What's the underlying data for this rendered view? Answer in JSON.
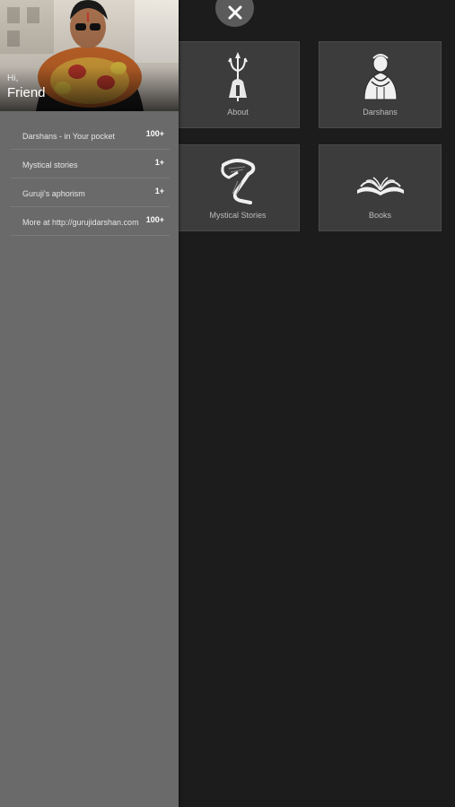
{
  "close_button": {
    "icon": "close-icon"
  },
  "tiles": {
    "about": {
      "label": "About",
      "icon": "trident-icon"
    },
    "darshans": {
      "label": "Darshans",
      "icon": "guru-portrait-icon"
    },
    "stories": {
      "label": "Mystical Stories",
      "icon": "cobra-icon"
    },
    "books": {
      "label": "Books",
      "icon": "open-book-icon"
    }
  },
  "drawer": {
    "greeting": "Hi,",
    "name": "Friend",
    "profile_image": "guru-photo-with-garlands",
    "items": [
      {
        "label": "Darshans - in Your pocket",
        "count": "100+"
      },
      {
        "label": "Mystical stories",
        "count": "1+"
      },
      {
        "label": "Guruji's aphorism",
        "count": "1+"
      },
      {
        "label": "More at http://gurujidarshan.com",
        "count": "100+"
      }
    ]
  },
  "colors": {
    "background": "#1c1c1c",
    "tile": "#3c3c3c",
    "drawer": "#6a6a6a",
    "close_button": "#5b5b5b"
  }
}
